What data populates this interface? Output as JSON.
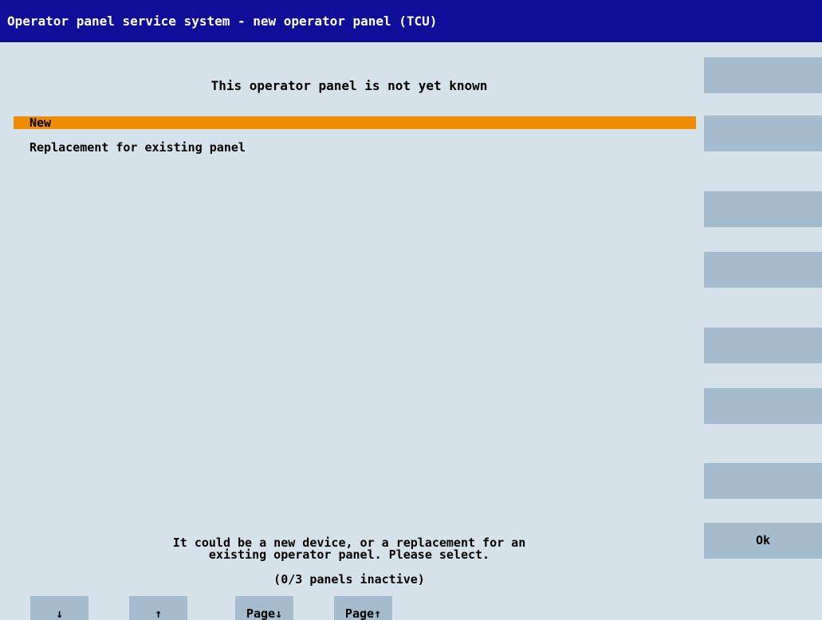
{
  "window": {
    "title": "Operator panel service system - new operator panel (TCU)"
  },
  "main": {
    "heading": "This operator panel is not yet known",
    "options": [
      {
        "label": "New",
        "selected": true
      },
      {
        "label": "Replacement for existing panel",
        "selected": false
      }
    ],
    "message_line1": "It could be a new device, or a replacement for an",
    "message_line2": "existing operator panel. Please select.",
    "status": "(0/3 panels inactive)"
  },
  "vertical_softkeys": [
    {
      "label": ""
    },
    {
      "label": ""
    },
    {
      "label": ""
    },
    {
      "label": ""
    },
    {
      "label": ""
    },
    {
      "label": ""
    },
    {
      "label": ""
    },
    {
      "label": "Ok"
    }
  ],
  "horizontal_softkeys": [
    {
      "label": "↓"
    },
    {
      "label": "↑"
    },
    {
      "label": "Page↓"
    },
    {
      "label": "Page↑"
    }
  ],
  "colors": {
    "titlebar": "#0e0e99",
    "background": "#d6e2ea",
    "softkey": "#a4bccd",
    "selection": "#f08c00"
  }
}
